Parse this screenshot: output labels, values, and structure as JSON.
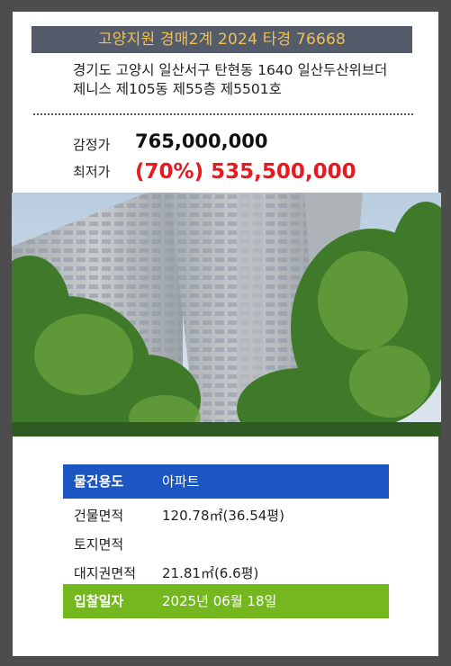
{
  "header": {
    "court_case": "고양지원 경매2계 2024 타경 76668"
  },
  "address": "경기도 고양시 일산서구 탄현동 1640 일산두산위브더제니스 제105동 제55층 제5501호",
  "prices": {
    "appraisal_label": "감정가",
    "appraisal_value": "765,000,000",
    "minimum_label": "최저가",
    "minimum_value": "(70%) 535,500,000"
  },
  "details": {
    "usage_label": "물건용도",
    "usage_value": "아파트",
    "building_area_label": "건물면적",
    "building_area_value": "120.78㎡(36.54평)",
    "land_area_label": "토지면적",
    "land_area_value": "",
    "land_right_label": "대지권면적",
    "land_right_value": "21.81㎡(6.6평)",
    "bid_date_label": "입찰일자",
    "bid_date_value": "2025년 06월 18일"
  },
  "colors": {
    "frame": "#4d4d4d",
    "header_bg": "#545c6b",
    "header_text": "#f2c14e",
    "minimum_price": "#e8191f",
    "usage_row": "#1c56c3",
    "bid_date_row": "#74b71f"
  }
}
